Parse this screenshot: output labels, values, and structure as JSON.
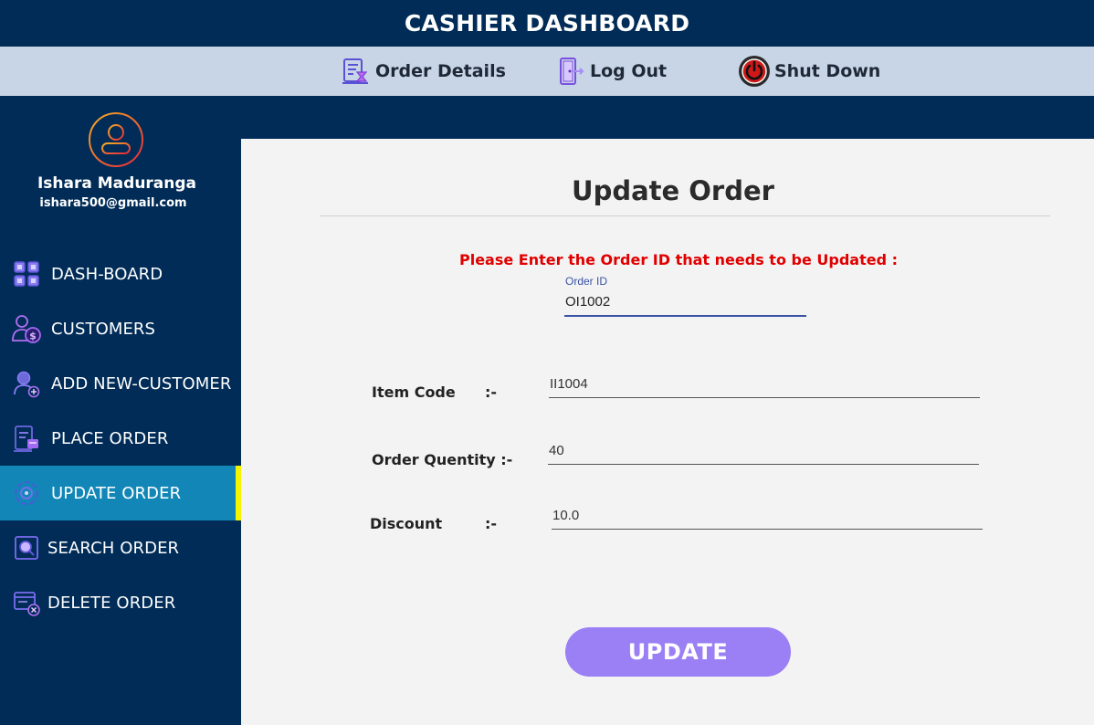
{
  "app": {
    "title": "CASHIER DASHBOARD"
  },
  "topnav": {
    "order_details": {
      "label": "Order Details",
      "icon": "order-details-icon"
    },
    "log_out": {
      "label": "Log Out",
      "icon": "logout-door-icon"
    },
    "shut_down": {
      "label": "Shut Down",
      "icon": "power-icon"
    }
  },
  "user": {
    "name": "Ishara Maduranga",
    "email": "ishara500@gmail.com"
  },
  "sidebar": {
    "items": [
      {
        "label": "DASH-BOARD",
        "icon": "dashboard-grid-icon"
      },
      {
        "label": "CUSTOMERS",
        "icon": "customers-icon"
      },
      {
        "label": "ADD NEW-CUSTOMER",
        "icon": "add-customer-icon"
      },
      {
        "label": "PLACE ORDER",
        "icon": "place-order-icon"
      },
      {
        "label": "UPDATE ORDER",
        "icon": "update-order-icon",
        "active": true
      },
      {
        "label": "SEARCH ORDER",
        "icon": "search-order-icon"
      },
      {
        "label": "DELETE ORDER",
        "icon": "delete-order-icon"
      }
    ]
  },
  "form": {
    "heading": "Update Order",
    "prompt": "Please Enter the Order ID that needs to be Updated :",
    "order_id": {
      "label": "Order ID",
      "value": "OI1002"
    },
    "item_code": {
      "label": "Item Code",
      "separator": ":-",
      "value": "II1004"
    },
    "order_quantity": {
      "label": "Order Quentity :-",
      "value": "40"
    },
    "discount": {
      "label": "Discount",
      "separator": ":-",
      "value": "10.0"
    },
    "submit_label": "UPDATE"
  },
  "colors": {
    "navy": "#002c57",
    "topnav_bg": "#c7d5e6",
    "active_item": "#1287b7",
    "active_marker": "#f4f400",
    "prompt_red": "#e00000",
    "button_purple": "#9b7ff5"
  }
}
